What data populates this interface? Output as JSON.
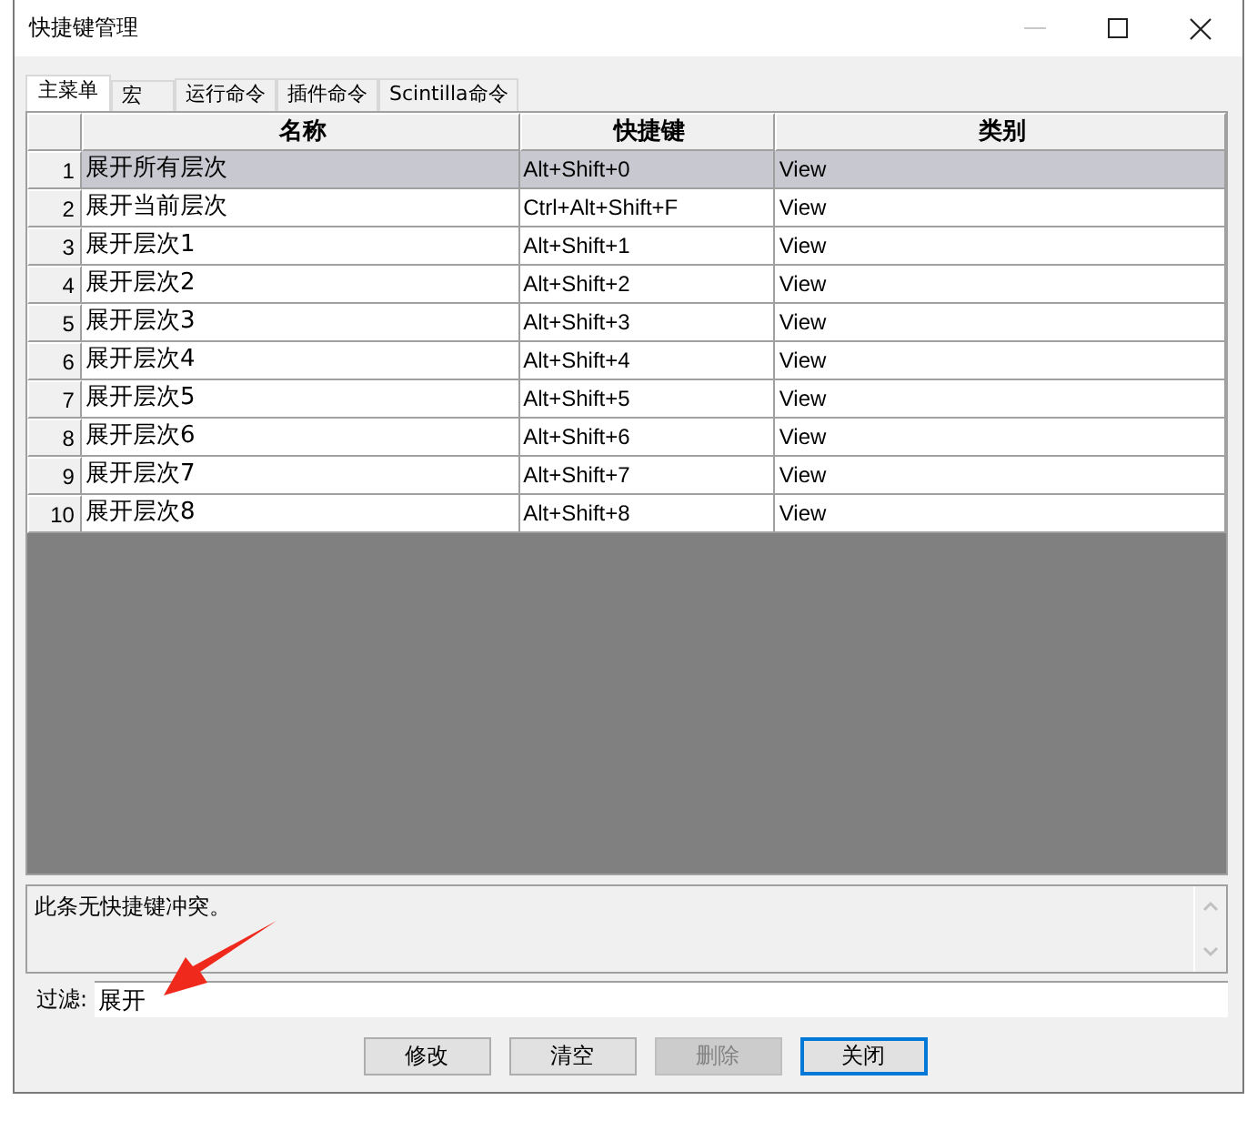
{
  "window": {
    "title": "快捷键管理"
  },
  "tabs": [
    {
      "label": "主菜单",
      "selected": true
    },
    {
      "label": "宏",
      "selected": false
    },
    {
      "label": "运行命令",
      "selected": false
    },
    {
      "label": "插件命令",
      "selected": false
    },
    {
      "label": "Scintilla命令",
      "selected": false
    }
  ],
  "table": {
    "columns": [
      "名称",
      "快捷键",
      "类别"
    ],
    "rows": [
      {
        "index": "1",
        "name": "展开所有层次",
        "shortcut": "Alt+Shift+0",
        "category": "View",
        "selected": true
      },
      {
        "index": "2",
        "name": "展开当前层次",
        "shortcut": "Ctrl+Alt+Shift+F",
        "category": "View",
        "selected": false
      },
      {
        "index": "3",
        "name": "展开层次1",
        "shortcut": "Alt+Shift+1",
        "category": "View",
        "selected": false
      },
      {
        "index": "4",
        "name": "展开层次2",
        "shortcut": "Alt+Shift+2",
        "category": "View",
        "selected": false
      },
      {
        "index": "5",
        "name": "展开层次3",
        "shortcut": "Alt+Shift+3",
        "category": "View",
        "selected": false
      },
      {
        "index": "6",
        "name": "展开层次4",
        "shortcut": "Alt+Shift+4",
        "category": "View",
        "selected": false
      },
      {
        "index": "7",
        "name": "展开层次5",
        "shortcut": "Alt+Shift+5",
        "category": "View",
        "selected": false
      },
      {
        "index": "8",
        "name": "展开层次6",
        "shortcut": "Alt+Shift+6",
        "category": "View",
        "selected": false
      },
      {
        "index": "9",
        "name": "展开层次7",
        "shortcut": "Alt+Shift+7",
        "category": "View",
        "selected": false
      },
      {
        "index": "10",
        "name": "展开层次8",
        "shortcut": "Alt+Shift+8",
        "category": "View",
        "selected": false
      }
    ]
  },
  "conflict_message": "此条无快捷键冲突。",
  "filter": {
    "label": "过滤:",
    "value": "展开"
  },
  "buttons": [
    {
      "label": "修改",
      "disabled": false,
      "focused": false
    },
    {
      "label": "清空",
      "disabled": false,
      "focused": false
    },
    {
      "label": "删除",
      "disabled": true,
      "focused": false
    },
    {
      "label": "关闭",
      "disabled": false,
      "focused": true
    }
  ]
}
